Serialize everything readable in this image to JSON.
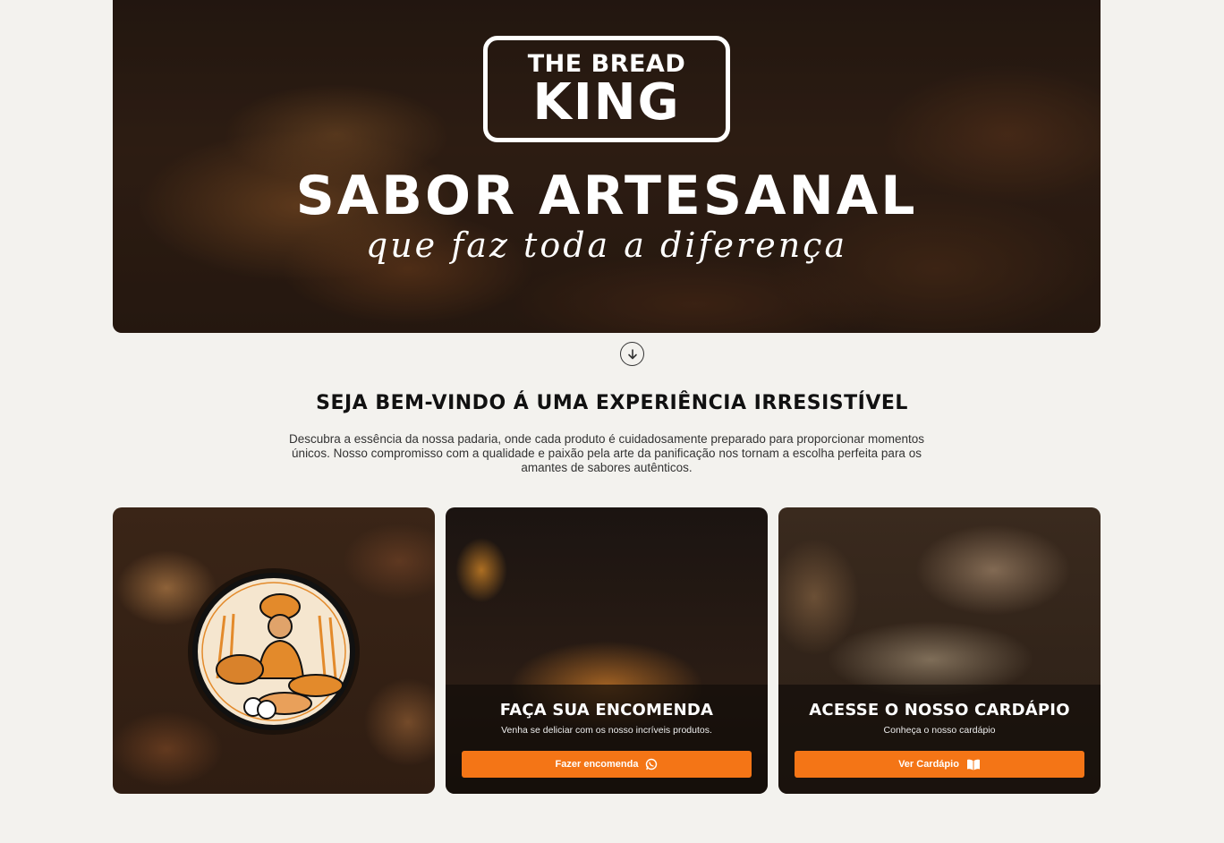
{
  "hero": {
    "logo_line1": "THE BREAD",
    "logo_line2": "KING",
    "title": "SABOR ARTESANAL",
    "script": "que faz toda a diferença"
  },
  "scroll": {
    "icon": "arrow-down-circle-icon"
  },
  "welcome": {
    "title": "SEJA BEM-VINDO Á UMA EXPERIÊNCIA IRRESISTÍVEL",
    "text": "Descubra a essência da nossa padaria, onde cada produto é cuidadosamente preparado para proporcionar momentos únicos. Nosso compromisso com a qualidade e paixão pela arte da panificação nos tornam a escolha perfeita para os amantes de sabores autênticos."
  },
  "cards": [
    {
      "type": "image",
      "icon": "baker-emblem-icon"
    },
    {
      "title": "FAÇA SUA ENCOMENDA",
      "subtitle": "Venha se deliciar com os nosso incríveis produtos.",
      "button": "Fazer encomenda",
      "button_icon": "whatsapp-icon"
    },
    {
      "title": "ACESSE O NOSSO CARDÁPIO",
      "subtitle": "Conheça o nosso cardápio",
      "button": "Ver Cardápio",
      "button_icon": "book-open-icon"
    }
  ],
  "colors": {
    "accent": "#f47516",
    "background": "#f3f2ee"
  }
}
